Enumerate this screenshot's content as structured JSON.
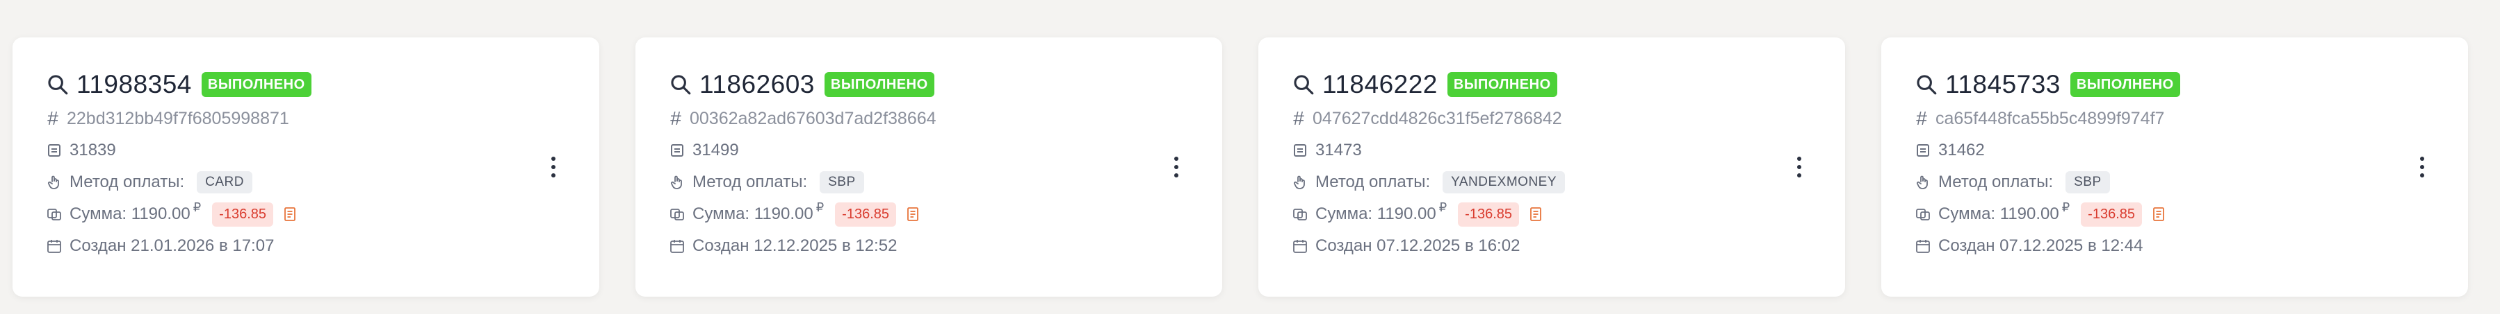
{
  "cards": [
    {
      "order_number": "11988354",
      "status": "ВЫПОЛНЕНО",
      "hash": "22bd312bb49f7f6805998871",
      "id": "31839",
      "method_label": "Метод оплаты:",
      "method": "CARD",
      "sum_label": "Сумма: 1190.00",
      "currency": "₽",
      "fee": "-136.85",
      "created": "Создан 21.01.2026 в 17:07"
    },
    {
      "order_number": "11862603",
      "status": "ВЫПОЛНЕНО",
      "hash": "00362a82ad67603d7ad2f38664",
      "id": "31499",
      "method_label": "Метод оплаты:",
      "method": "SBP",
      "sum_label": "Сумма: 1190.00",
      "currency": "₽",
      "fee": "-136.85",
      "created": "Создан 12.12.2025 в 12:52"
    },
    {
      "order_number": "11846222",
      "status": "ВЫПОЛНЕНО",
      "hash": "047627cdd4826c31f5ef2786842",
      "id": "31473",
      "method_label": "Метод оплаты:",
      "method": "YANDEXMONEY",
      "sum_label": "Сумма: 1190.00",
      "currency": "₽",
      "fee": "-136.85",
      "created": "Создан 07.12.2025 в 16:02"
    },
    {
      "order_number": "11845733",
      "status": "ВЫПОЛНЕНО",
      "hash": "ca65f448fca55b5c4899f974f7",
      "id": "31462",
      "method_label": "Метод оплаты:",
      "method": "SBP",
      "sum_label": "Сумма: 1190.00",
      "currency": "₽",
      "fee": "-136.85",
      "created": "Создан 07.12.2025 в 12:44"
    }
  ],
  "icons": {
    "search": "search-icon",
    "hash": "hash-icon",
    "id": "card-icon",
    "method": "pointer-hand-icon",
    "sum": "coins-icon",
    "receipt": "receipt-icon",
    "created": "calendar-icon",
    "menu": "kebab-menu-icon"
  },
  "colors": {
    "status_bg": "#4cd137",
    "fee_bg": "#fde1de",
    "fee_text": "#d93b2e",
    "receipt_icon": "#e8743b"
  }
}
